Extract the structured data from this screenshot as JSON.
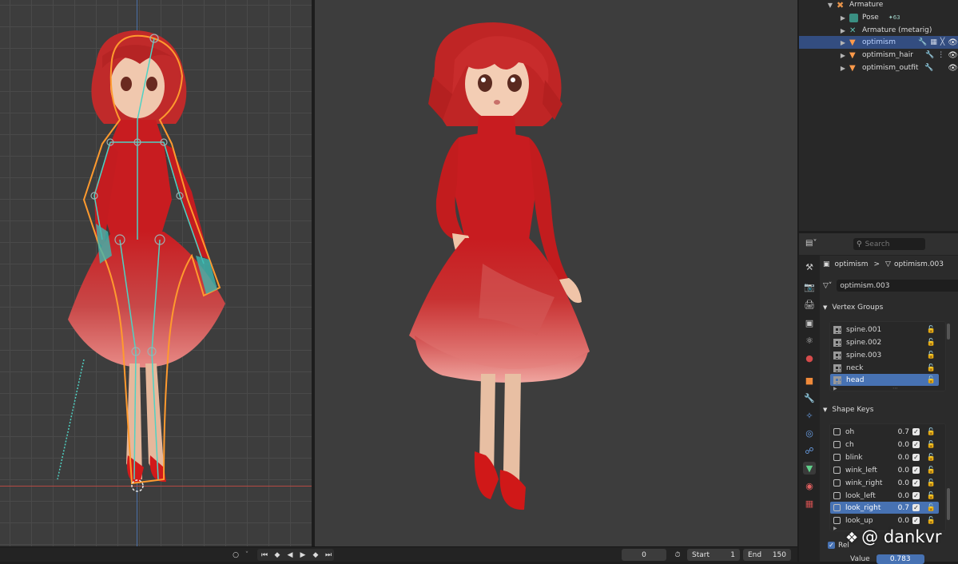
{
  "outliner": {
    "rows": [
      {
        "label": "Armature"
      },
      {
        "label": "Pose",
        "badge": "63"
      },
      {
        "label": "Armature (metarig)"
      },
      {
        "label": "optimism",
        "selected": true
      },
      {
        "label": "optimism_hair"
      },
      {
        "label": "optimism_outfit"
      }
    ]
  },
  "properties": {
    "search_placeholder": "Search",
    "breadcrumb_object": "optimism",
    "breadcrumb_separator": ">",
    "breadcrumb_mesh": "optimism.003",
    "mesh_datablock": "optimism.003",
    "vertex_groups": {
      "title": "Vertex Groups",
      "items": [
        "spine.001",
        "spine.002",
        "spine.003",
        "neck",
        "head"
      ],
      "selected_index": 4
    },
    "shape_keys": {
      "title": "Shape Keys",
      "items": [
        {
          "name": "oh",
          "value": "0.7"
        },
        {
          "name": "ch",
          "value": "0.0"
        },
        {
          "name": "blink",
          "value": "0.0"
        },
        {
          "name": "wink_left",
          "value": "0.0"
        },
        {
          "name": "wink_right",
          "value": "0.0"
        },
        {
          "name": "look_left",
          "value": "0.0"
        },
        {
          "name": "look_right",
          "value": "0.7"
        },
        {
          "name": "look_up",
          "value": "0.0"
        }
      ],
      "selected_index": 6,
      "relative_label": "Rel",
      "value_label": "Value",
      "value": "0.783"
    }
  },
  "timeline": {
    "current_frame": "0",
    "start_label": "Start",
    "start_value": "1",
    "end_label": "End",
    "end_value": "150"
  },
  "watermark": "@ dankvr",
  "colors": {
    "accent": "#4772b3",
    "outliner_selection": "#334d80",
    "character_dress": "#c81c20",
    "armature_outline": "#ff9a2e",
    "bone_color": "#4fd2c4"
  }
}
